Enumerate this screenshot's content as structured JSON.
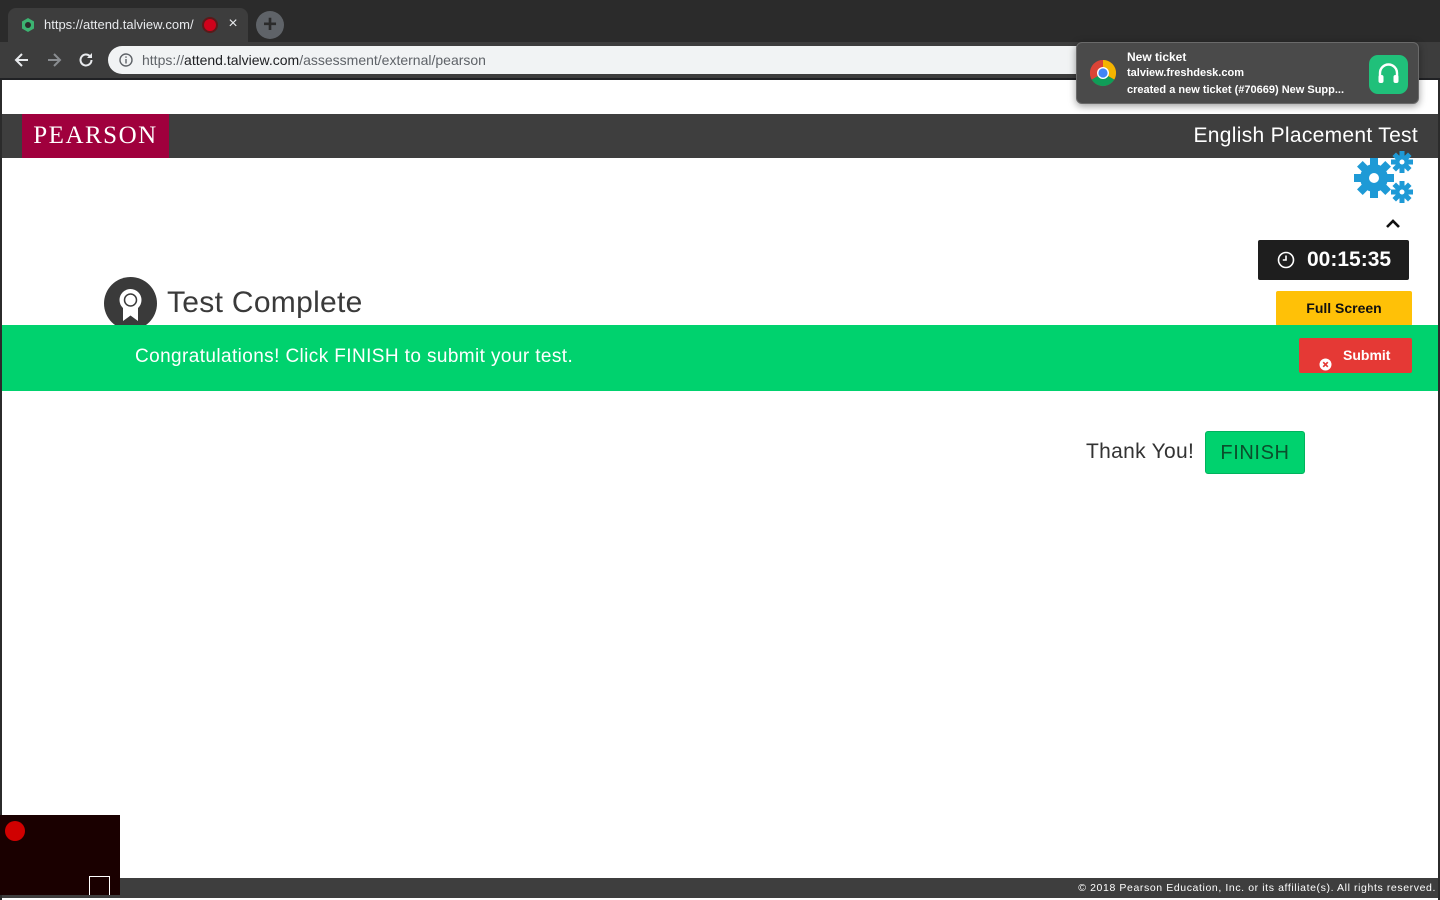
{
  "browser": {
    "tab_title": "https://attend.talview.com/",
    "tab_close_glyph": "×",
    "new_tab_glyph": "+",
    "url_scheme": "https://",
    "url_host": "attend.talview.com",
    "url_path": "/assessment/external/pearson"
  },
  "notification": {
    "title": "New ticket",
    "source": "talview.freshdesk.com",
    "body": "created a new ticket (#70669) New Supp..."
  },
  "header": {
    "logo_text": "PEARSON",
    "title": "English Placement Test"
  },
  "widgets": {
    "timer": "00:15:35",
    "fullscreen_label": "Full Screen",
    "submit_label": "Submit"
  },
  "main": {
    "section_title": "Test Complete",
    "banner_text": "Congratulations! Click FINISH to submit your test.",
    "thank_you": "Thank You!",
    "finish_label": "FINISH"
  },
  "footer": {
    "copyright": "© 2018 Pearson Education, Inc. or its affiliate(s). All rights reserved."
  },
  "colors": {
    "brand": "#a0003d",
    "banner": "#00d26e",
    "header_bg": "#3e3e3e",
    "fullscreen_btn": "#ffc107",
    "submit_btn": "#e53935",
    "gear": "#1e9ad6"
  }
}
